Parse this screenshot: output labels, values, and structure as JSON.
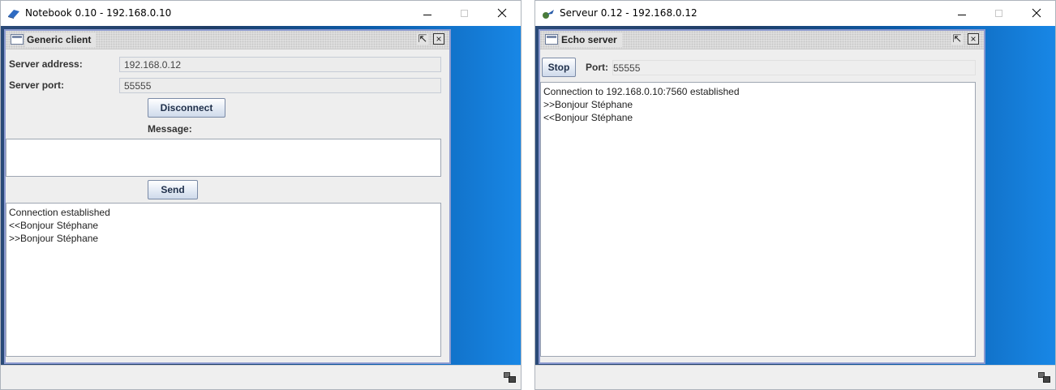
{
  "left_window": {
    "title": "Notebook 0.10 - 192.168.0.10",
    "app_icon": "notebook-icon",
    "frame": {
      "title": "Generic client",
      "restore_glyph": "⇱",
      "close_glyph": "×"
    },
    "server_address_label": "Server address:",
    "server_address_value": "192.168.0.12",
    "server_port_label": "Server port:",
    "server_port_value": "55555",
    "disconnect_label": "Disconnect",
    "message_label": "Message:",
    "message_value": "",
    "send_label": "Send",
    "log": [
      "Connection established",
      "<<Bonjour Stéphane",
      ">>Bonjour Stéphane"
    ]
  },
  "right_window": {
    "title": "Serveur 0.12 - 192.168.0.12",
    "app_icon": "server-icon",
    "frame": {
      "title": "Echo server",
      "restore_glyph": "⇱",
      "close_glyph": "×"
    },
    "stop_label": "Stop",
    "port_label": "Port:",
    "port_value": "55555",
    "log": [
      "Connection to 192.168.0.10:7560 established",
      ">>Bonjour Stéphane",
      "<<Bonjour Stéphane"
    ]
  },
  "colors": {
    "desktop_dark": "#1f3d66",
    "desktop_light": "#1887e6",
    "frame_border": "#8c9ad0"
  }
}
